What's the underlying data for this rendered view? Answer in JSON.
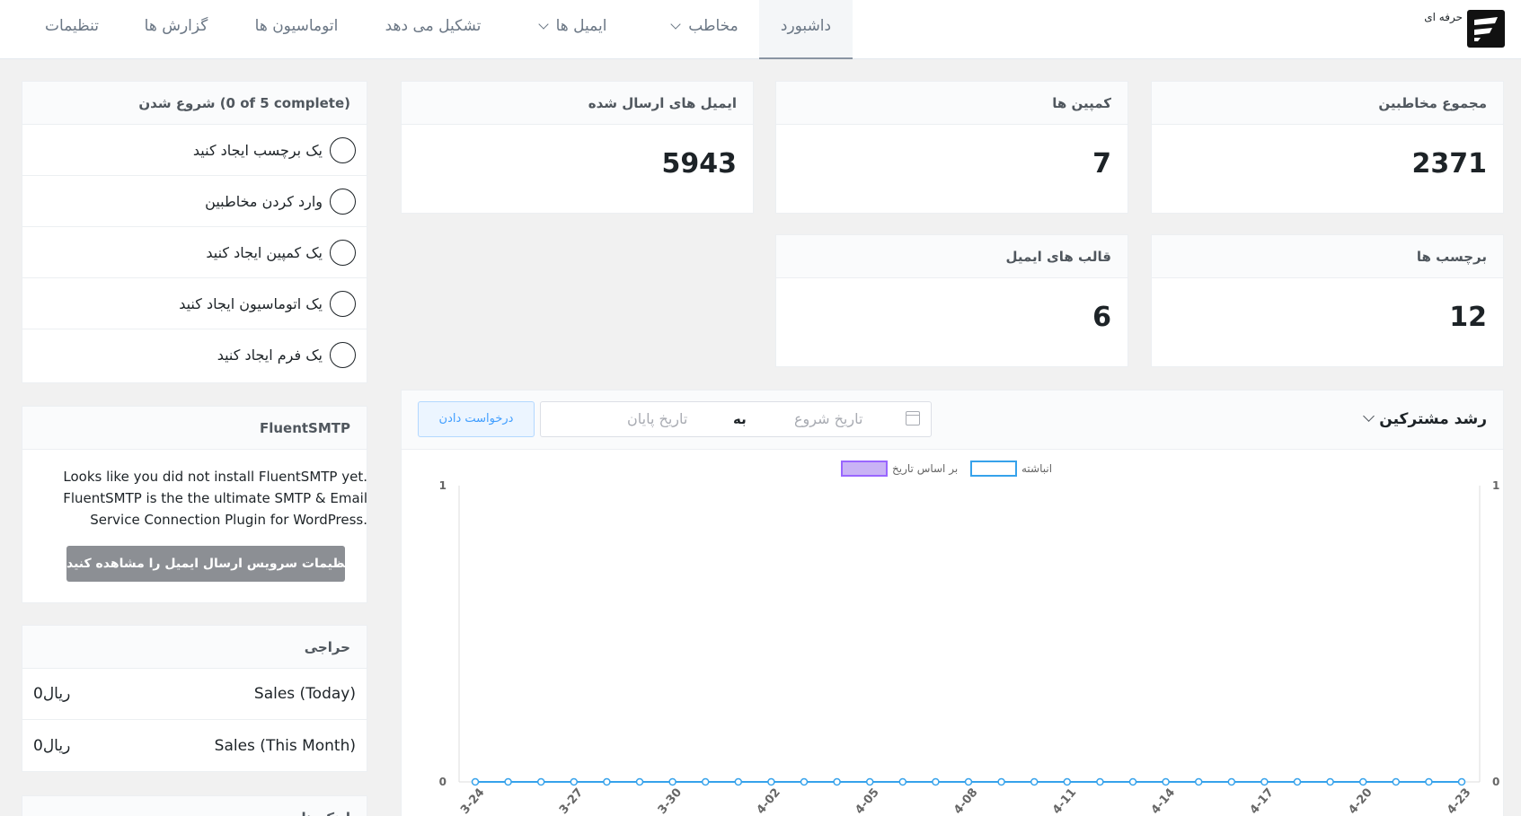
{
  "brand": {
    "label": "حرفه ای"
  },
  "nav": [
    {
      "label": "داشبورد",
      "active": true,
      "dropdown": false
    },
    {
      "label": "مخاطب",
      "active": false,
      "dropdown": true
    },
    {
      "label": "ایمیل ها",
      "active": false,
      "dropdown": true
    },
    {
      "label": "تشکیل می دهد",
      "active": false,
      "dropdown": false
    },
    {
      "label": "اتوماسیون ها",
      "active": false,
      "dropdown": false
    },
    {
      "label": "گزارش ها",
      "active": false,
      "dropdown": false
    },
    {
      "label": "تنظیمات",
      "active": false,
      "dropdown": false
    }
  ],
  "stats": {
    "total_contacts": {
      "label": "مجموع مخاطبین",
      "value": "2371"
    },
    "campaigns": {
      "label": "کمپین ها",
      "value": "7"
    },
    "emails_sent": {
      "label": "ایمیل های ارسال شده",
      "value": "5943"
    },
    "tags": {
      "label": "برچسب ها",
      "value": "12"
    },
    "email_templates": {
      "label": "قالب های ایمیل",
      "value": "6"
    }
  },
  "onboarding": {
    "title": "شروع شدن (0 of 5 complete)",
    "items": [
      {
        "label": "یک برچسب ایجاد کنید"
      },
      {
        "label": "وارد کردن مخاطبین"
      },
      {
        "label": "یک کمپین ایجاد کنید"
      },
      {
        "label": "یک اتوماسیون ایجاد کنید"
      },
      {
        "label": "یک فرم ایجاد کنید"
      }
    ]
  },
  "smtp": {
    "title": "FluentSMTP",
    "message": "Looks like you did not install FluentSMTP yet. FluentSMTP is the the ultimate SMTP & Email Service Connection Plugin for WordPress.",
    "button": "تنظیمات سرویس ارسال ایمیل را مشاهده کنید"
  },
  "sales": {
    "title": "حراجی",
    "rows": [
      {
        "label": "Sales (Today)",
        "value": "0ریال"
      },
      {
        "label": "Sales (This Month)",
        "value": "0ریال"
      }
    ]
  },
  "quick_links": {
    "title": "لینک های سریع"
  },
  "growth": {
    "title": "رشد مشترکین",
    "start_placeholder": "تاریخ شروع",
    "separator": "به",
    "end_placeholder": "تاریخ پایان",
    "apply_label": "درخواست دادن"
  },
  "chart_data": {
    "type": "line",
    "legend_position": "top-center",
    "series": [
      {
        "name": "انباشته",
        "color": "#36a2eb",
        "values": [
          0,
          0,
          0,
          0,
          0,
          0,
          0,
          0,
          0,
          0,
          0,
          0,
          0,
          0,
          0,
          0,
          0,
          0,
          0,
          0,
          0,
          0,
          0,
          0,
          0,
          0,
          0,
          0,
          0,
          0,
          0
        ]
      },
      {
        "name": "بر اساس تاریخ",
        "color": "#9966ff",
        "values": [
          0,
          0,
          0,
          0,
          0,
          0,
          0,
          0,
          0,
          0,
          0,
          0,
          0,
          0,
          0,
          0,
          0,
          0,
          0,
          0,
          0,
          0,
          0,
          0,
          0,
          0,
          0,
          0,
          0,
          0,
          0
        ]
      }
    ],
    "ylim": [
      0,
      1
    ],
    "yticks": [
      "0",
      "1"
    ],
    "xtick_labels": [
      "3-24",
      "3-27",
      "3-30",
      "4-02",
      "4-05",
      "4-08",
      "4-11",
      "4-14",
      "4-17",
      "4-20",
      "4-23"
    ],
    "grid": false
  }
}
